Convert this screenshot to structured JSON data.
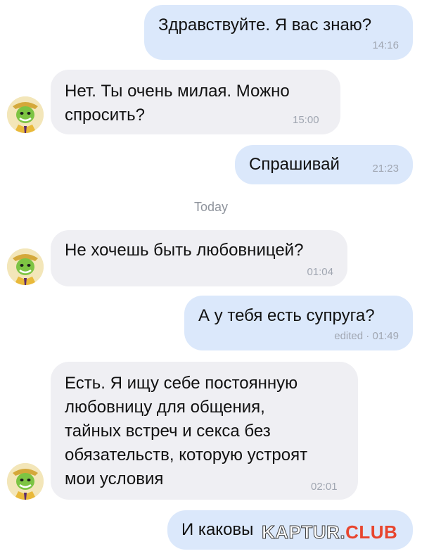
{
  "messages": [
    {
      "direction": "outgoing",
      "text": "Здравствуйте. Я вас знаю?",
      "time": "14:16"
    },
    {
      "direction": "incoming",
      "text": "Нет. Ты очень милая. Можно\nспросить?",
      "time": "15:00"
    },
    {
      "direction": "outgoing",
      "text": "Спрашивай",
      "time": "21:23"
    },
    {
      "direction": "incoming",
      "text": "Не хочешь быть любовницей?",
      "time": "01:04"
    },
    {
      "direction": "outgoing",
      "text": "А у тебя есть супруга?",
      "time": "edited · 01:49"
    },
    {
      "direction": "incoming",
      "text": "Есть. Я ищу себе постоянную\nлюбовницу для общения,\nтайных встреч и секса без\nобязательств, которую устроят\nмои условия",
      "time": "02:01"
    },
    {
      "direction": "outgoing",
      "text": "И каковы",
      "time": ""
    }
  ],
  "day_separator": "Today",
  "watermark": {
    "part1": "KAPTUR.",
    "part2": "CLUB"
  },
  "colors": {
    "outgoing_bubble": "#dbe8fb",
    "incoming_bubble": "#efeff3",
    "timestamp": "#a0a6b1",
    "watermark_accent": "#e8452e"
  },
  "icons": {
    "avatar": "green-mask-character-avatar"
  }
}
